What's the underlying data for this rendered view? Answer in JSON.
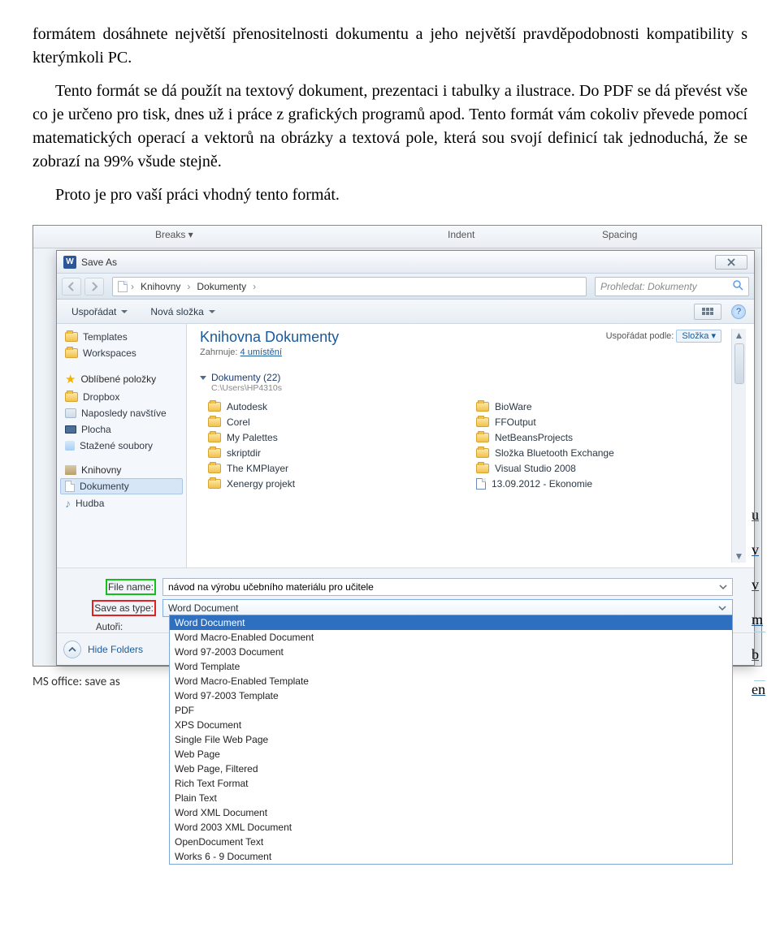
{
  "prose": {
    "p1": "formátem dosáhnete největší přenositelnosti dokumentu a jeho největší pravděpodobnosti kompatibility s kterýmkoli PC.",
    "p2": "Tento formát se dá použít na textový dokument, prezentaci i tabulky a ilustrace. Do PDF se dá převést vše co je určeno pro tisk, dnes už i práce z grafických programů apod. Tento formát vám cokoliv převede pomocí matematických operací a vektorů na obrázky a textová pole, která sou svojí definicí tak jednoduchá, že se zobrazí na 99% všude stejně.",
    "p3": "Proto je pro vaší práci vhodný tento formát."
  },
  "ribbon": {
    "breaks": "Breaks ▾",
    "indent": "Indent",
    "spacing": "Spacing"
  },
  "dialog": {
    "title": "Save As",
    "word_glyph": "W"
  },
  "breadcrumb": {
    "seg1": "Knihovny",
    "seg2": "Dokumenty"
  },
  "search": {
    "placeholder": "Prohledat: Dokumenty"
  },
  "toolbar": {
    "organize": "Uspořádat",
    "newfolder": "Nová složka"
  },
  "nav": {
    "templates": "Templates",
    "workspaces": "Workspaces",
    "fav": "Oblíbené položky",
    "dropbox": "Dropbox",
    "recent": "Naposledy navštíve",
    "desktop": "Plocha",
    "downloads": "Stažené soubory",
    "libs": "Knihovny",
    "docs": "Dokumenty",
    "music": "Hudba"
  },
  "lib": {
    "title": "Knihovna Dokumenty",
    "sub_prefix": "Zahrnuje: ",
    "sub_link": "4 umístění",
    "sort_label": "Uspořádat podle:",
    "sort_value": "Složka ▾",
    "section": "Dokumenty (22)",
    "section_sub": "C:\\Users\\HP4310s"
  },
  "folders": {
    "c": [
      "Autodesk",
      "BioWare",
      "Corel",
      "FFOutput",
      "My Palettes",
      "NetBeansProjects",
      "skriptdir",
      "Složka Bluetooth Exchange",
      "The KMPlayer",
      "Visual Studio 2008",
      "Xenergy projekt",
      "13.09.2012 - Ekonomie"
    ]
  },
  "form": {
    "filename_label": "File name:",
    "filename_value": "návod na výrobu učebního materiálu pro učitele",
    "savetype_label": "Save as type:",
    "savetype_value": "Word Document",
    "authors_label": "Autoři:"
  },
  "dropdown": [
    "Word Document",
    "Word Macro-Enabled Document",
    "Word 97-2003 Document",
    "Word Template",
    "Word Macro-Enabled Template",
    "Word 97-2003 Template",
    "PDF",
    "XPS Document",
    "Single File Web Page",
    "Web Page",
    "Web Page, Filtered",
    "Rich Text Format",
    "Plain Text",
    "Word XML Document",
    "Word 2003 XML Document",
    "OpenDocument Text",
    "Works 6 - 9 Document"
  ],
  "bottom": {
    "hide": "Hide Folders"
  },
  "edge_letters": [
    "u",
    "v",
    "v",
    "m",
    "b",
    "en"
  ],
  "caption": "MS office: save as"
}
